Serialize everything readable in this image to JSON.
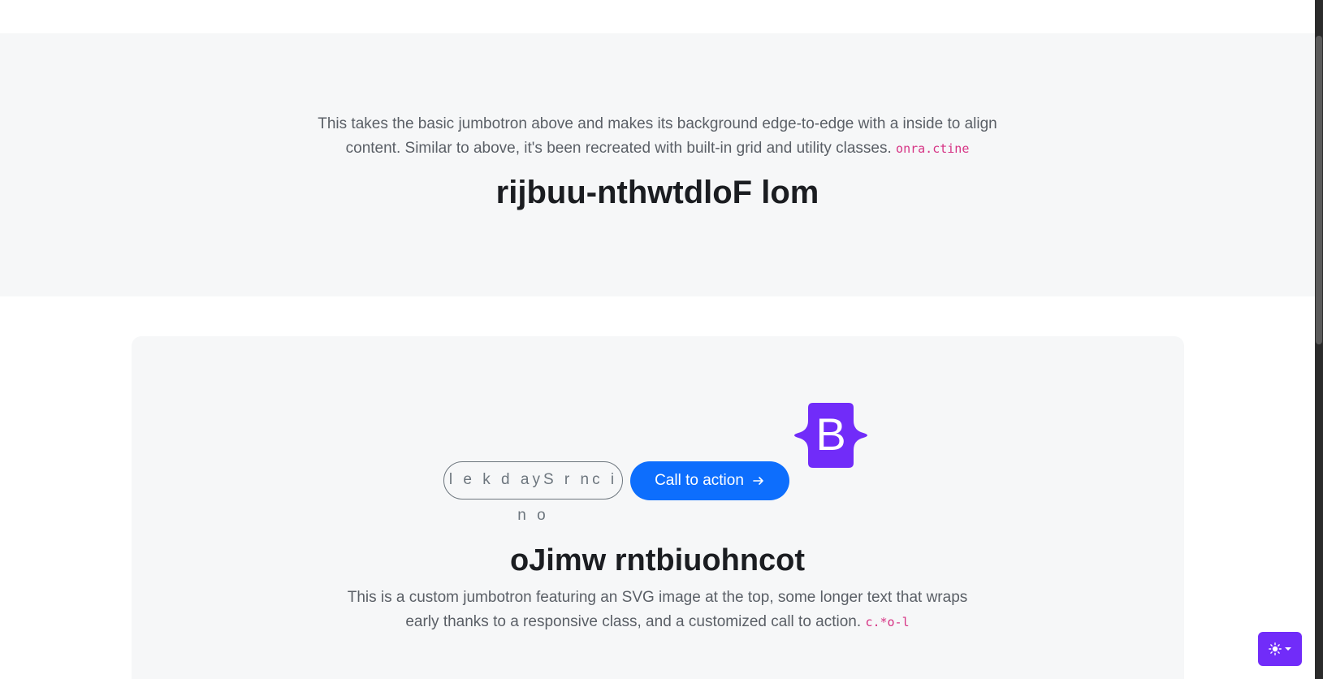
{
  "full_width_jumbotron": {
    "lead_text": "This takes the basic jumbotron above and makes its background edge-to-edge with a inside to align content. Similar to above, it's been recreated with built-in grid and utility classes.",
    "code_snippet": "onra.ctine",
    "title": "rijbuu-nthwtdloF lom"
  },
  "custom_jumbotron": {
    "logo_letter": "B",
    "logo_color": "#712cf9",
    "secondary_button_label": "l e k d ayS r nc i n o",
    "primary_button_label": "Call to action",
    "primary_button_icon": "arrow-right-icon",
    "primary_color": "#0d6efd",
    "title": "oJimw rntbiuohncot",
    "lead_text": "This is a custom jumbotron featuring an SVG image at the top, some longer text that wraps early thanks to a responsive class, and a customized call to action.",
    "code_snippet": "c.*o-l"
  },
  "theme_toggle": {
    "icon": "sun-icon",
    "caret": "chevron-down-icon",
    "color": "#712cf9"
  }
}
